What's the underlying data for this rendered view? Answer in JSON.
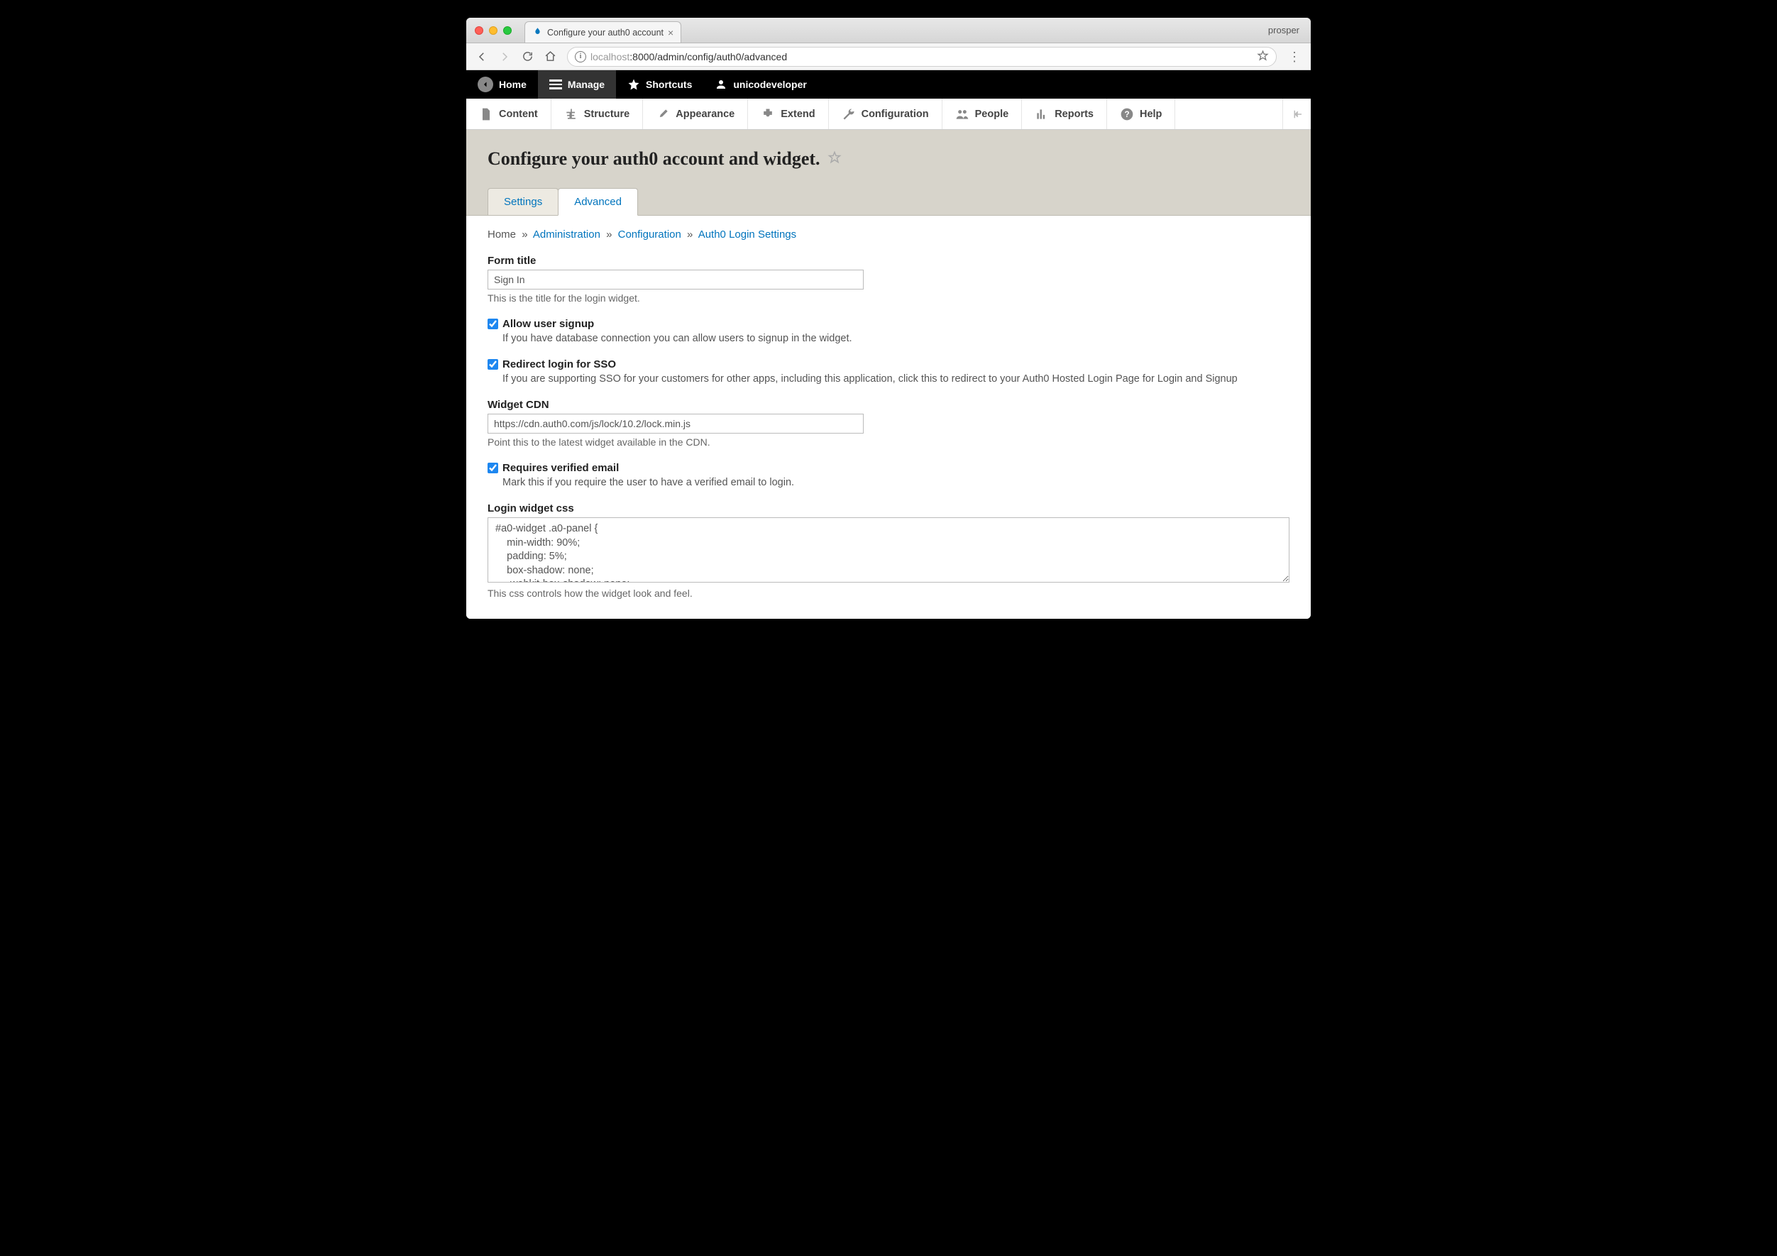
{
  "browser": {
    "tab_title": "Configure your auth0 account",
    "user_label": "prosper",
    "url_host_faded": "localhost",
    "url_port_path": ":8000/admin/config/auth0/advanced"
  },
  "admin_bar": {
    "home": "Home",
    "manage": "Manage",
    "shortcuts": "Shortcuts",
    "user": "unicodeveloper"
  },
  "toolbar": {
    "content": "Content",
    "structure": "Structure",
    "appearance": "Appearance",
    "extend": "Extend",
    "configuration": "Configuration",
    "people": "People",
    "reports": "Reports",
    "help": "Help"
  },
  "page": {
    "title": "Configure your auth0 account and widget."
  },
  "tabs": {
    "settings": "Settings",
    "advanced": "Advanced"
  },
  "breadcrumb": {
    "home": "Home",
    "administration": "Administration",
    "configuration": "Configuration",
    "auth0": "Auth0 Login Settings",
    "sep": "»"
  },
  "form": {
    "form_title": {
      "label": "Form title",
      "value": "Sign In",
      "description": "This is the title for the login widget."
    },
    "allow_signup": {
      "label": "Allow user signup",
      "checked": true,
      "description": "If you have database connection you can allow users to signup in the widget."
    },
    "redirect_sso": {
      "label": "Redirect login for SSO",
      "checked": true,
      "description": "If you are supporting SSO for your customers for other apps, including this application, click this to redirect to your Auth0 Hosted Login Page for Login and Signup"
    },
    "widget_cdn": {
      "label": "Widget CDN",
      "value": "https://cdn.auth0.com/js/lock/10.2/lock.min.js",
      "description": "Point this to the latest widget available in the CDN."
    },
    "requires_verified": {
      "label": "Requires verified email",
      "checked": true,
      "description": "Mark this if you require the user to have a verified email to login."
    },
    "login_css": {
      "label": "Login widget css",
      "value": "#a0-widget .a0-panel {\n    min-width: 90%;\n    padding: 5%;\n    box-shadow: none;\n    -webkit-box-shadow: none;",
      "description": "This css controls how the widget look and feel."
    }
  }
}
